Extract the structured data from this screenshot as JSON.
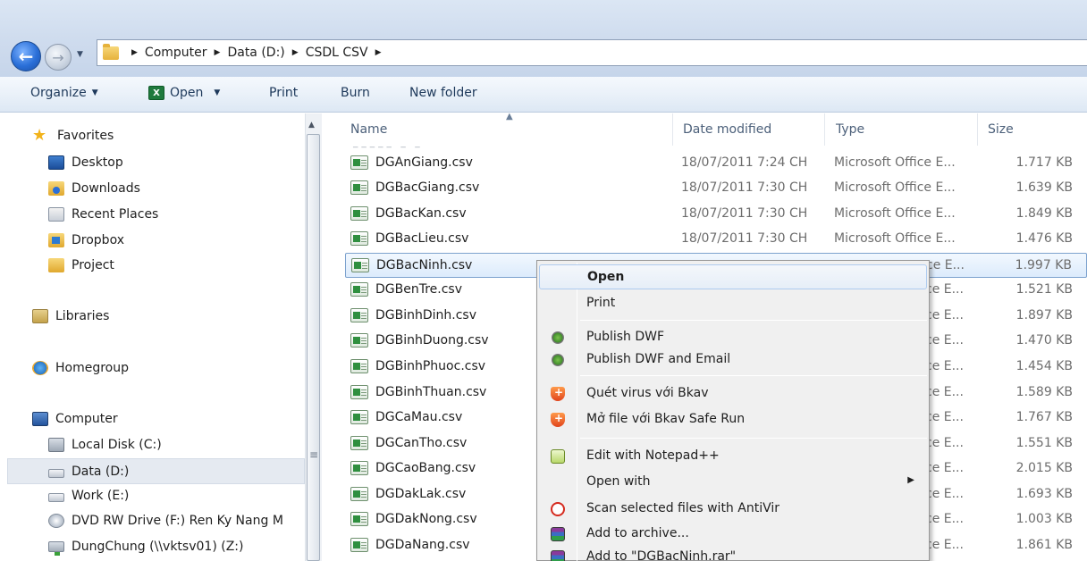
{
  "address": {
    "crumbs": [
      "Computer",
      "Data (D:)",
      "CSDL CSV"
    ]
  },
  "toolbar": {
    "organize": "Organize",
    "open": "Open",
    "print": "Print",
    "burn": "Burn",
    "new_folder": "New folder"
  },
  "nav": {
    "favorites": "Favorites",
    "desktop": "Desktop",
    "downloads": "Downloads",
    "recent_places": "Recent Places",
    "dropbox": "Dropbox",
    "project": "Project",
    "libraries": "Libraries",
    "homegroup": "Homegroup",
    "computer": "Computer",
    "local_disk": "Local Disk (C:)",
    "data": "Data (D:)",
    "work": "Work (E:)",
    "dvd": "DVD RW Drive (F:) Ren Ky Nang M",
    "dungchung": "DungChung (\\\\vktsv01) (Z:)"
  },
  "columns": {
    "name": "Name",
    "date": "Date modified",
    "type": "Type",
    "size": "Size"
  },
  "files": [
    {
      "name": "DGAnGiang.csv",
      "date": "18/07/2011 7:24 CH",
      "type": "Microsoft Office E...",
      "size": "1.717 KB"
    },
    {
      "name": "DGBacGiang.csv",
      "date": "18/07/2011 7:30 CH",
      "type": "Microsoft Office E...",
      "size": "1.639 KB"
    },
    {
      "name": "DGBacKan.csv",
      "date": "18/07/2011 7:30 CH",
      "type": "Microsoft Office E...",
      "size": "1.849 KB"
    },
    {
      "name": "DGBacLieu.csv",
      "date": "18/07/2011 7:30 CH",
      "type": "Microsoft Office E...",
      "size": "1.476 KB"
    },
    {
      "name": "DGBacNinh.csv",
      "date": "",
      "type": "ce E...",
      "size": "1.997 KB"
    },
    {
      "name": "DGBenTre.csv",
      "date": "",
      "type": "ce E...",
      "size": "1.521 KB"
    },
    {
      "name": "DGBinhDinh.csv",
      "date": "",
      "type": "ce E...",
      "size": "1.897 KB"
    },
    {
      "name": "DGBinhDuong.csv",
      "date": "",
      "type": "ce E...",
      "size": "1.470 KB"
    },
    {
      "name": "DGBinhPhuoc.csv",
      "date": "",
      "type": "ce E...",
      "size": "1.454 KB"
    },
    {
      "name": "DGBinhThuan.csv",
      "date": "",
      "type": "ce E...",
      "size": "1.589 KB"
    },
    {
      "name": "DGCaMau.csv",
      "date": "",
      "type": "ce E...",
      "size": "1.767 KB"
    },
    {
      "name": "DGCanTho.csv",
      "date": "",
      "type": "ce E...",
      "size": "1.551 KB"
    },
    {
      "name": "DGCaoBang.csv",
      "date": "",
      "type": "ce E...",
      "size": "2.015 KB"
    },
    {
      "name": "DGDakLak.csv",
      "date": "",
      "type": "ce E...",
      "size": "1.693 KB"
    },
    {
      "name": "DGDakNong.csv",
      "date": "",
      "type": "ce E...",
      "size": "1.003 KB"
    },
    {
      "name": "DGDaNang.csv",
      "date": "",
      "type": "ce E...",
      "size": "1.861 KB"
    }
  ],
  "context_menu": {
    "open": "Open",
    "print": "Print",
    "publish_dwf": "Publish DWF",
    "publish_dwf_email": "Publish DWF and Email",
    "bkav_scan": "Quét virus với Bkav",
    "bkav_safe_run": "Mở file với Bkav Safe Run",
    "notepadpp": "Edit with Notepad++",
    "open_with": "Open with",
    "antivir": "Scan selected files with AntiVir",
    "add_archive": "Add to archive...",
    "add_rar": "Add to \"DGBacNinh.rar\""
  }
}
